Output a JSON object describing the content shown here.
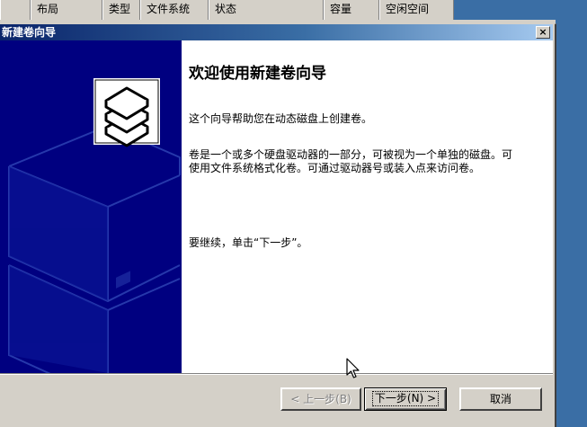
{
  "background_columns": [
    {
      "label": "布局"
    },
    {
      "label": "类型"
    },
    {
      "label": "文件系统"
    },
    {
      "label": "状态"
    },
    {
      "label": "容量"
    },
    {
      "label": "空闲空间"
    }
  ],
  "dialog": {
    "title": "新建卷向导",
    "close_label": "×",
    "welcome_title": "欢迎使用新建卷向导",
    "paragraph1": "这个向导帮助您在动态磁盘上创建卷。",
    "paragraph2": "卷是一个或多个硬盘驱动器的一部分，可被视为一个单独的磁盘。可使用文件系统格式化卷。可通过驱动器号或装入点来访问卷。",
    "paragraph3": "要继续，单击“下一步”。",
    "buttons": {
      "back": "< 上一步(B)",
      "next": "下一步(N) >",
      "cancel": "取消"
    }
  },
  "colors": {
    "side_panel": "#000080",
    "title_gradient_start": "#0a246a",
    "desktop": "#3a6ea5",
    "face": "#d4d0c8"
  },
  "icons": [
    "wizard-disk-stack-icon",
    "close-icon",
    "mouse-pointer-icon"
  ]
}
